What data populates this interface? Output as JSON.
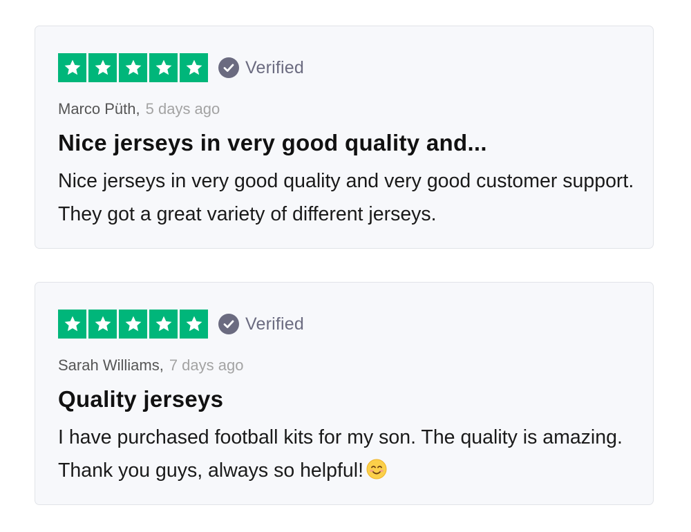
{
  "reviews": [
    {
      "rating": 5,
      "verified_label": "Verified",
      "author": "Marco Püth",
      "date": "5 days ago",
      "title": "Nice jerseys in very good quality and...",
      "body": "Nice jerseys in very good quality and very good customer support. They got a great variety of different jerseys.",
      "emoji": ""
    },
    {
      "rating": 5,
      "verified_label": "Verified",
      "author": "Sarah Williams",
      "date": "7 days ago",
      "title": "Quality jerseys",
      "body": "I have purchased football kits for my son. The quality is amazing. Thank you guys, always so helpful!",
      "emoji": "smiling-face-emoji"
    }
  ],
  "colors": {
    "star_green": "#00b67a",
    "verified_icon": "#6b6b80",
    "card_background": "#f7f8fb",
    "card_border": "#e1e3e8"
  },
  "icons": {
    "star": "star-icon",
    "verified": "check-circle-icon"
  }
}
